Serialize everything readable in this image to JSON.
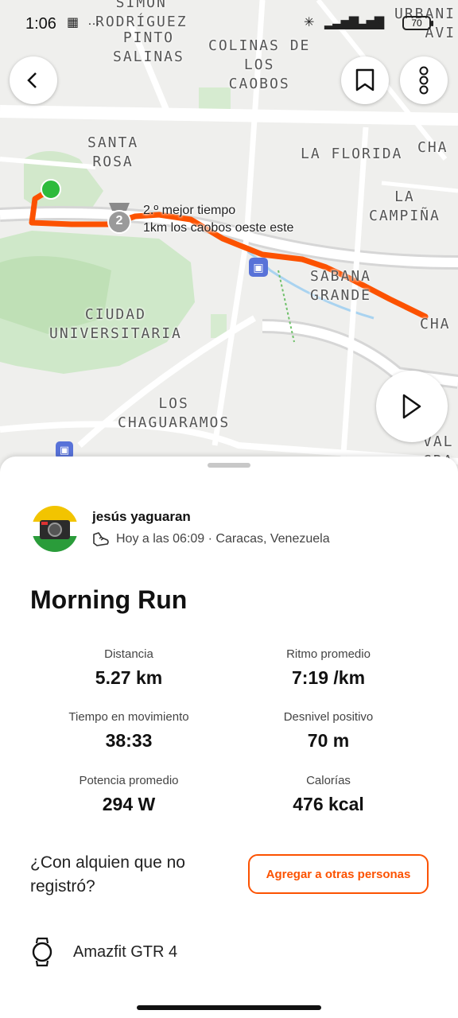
{
  "status_bar": {
    "time": "1:06",
    "battery": "70"
  },
  "map": {
    "labels": [
      {
        "id": "simon-rodriguez",
        "text": "SIMÓN\nRODRÍGUEZ"
      },
      {
        "id": "pinto-salinas",
        "text": "PINTO\nSALINAS"
      },
      {
        "id": "colinas",
        "text": "COLINAS DE\nLOS\nCAOBOS"
      },
      {
        "id": "urbani",
        "text": "URBANI\nAVI"
      },
      {
        "id": "santa-rosa",
        "text": "SANTA\nROSA"
      },
      {
        "id": "la-florida",
        "text": "LA FLORIDA"
      },
      {
        "id": "cha1",
        "text": "CHA"
      },
      {
        "id": "la-campina",
        "text": "LA\nCAMPIÑA"
      },
      {
        "id": "sabana-grande",
        "text": "SABANA\nGRANDE"
      },
      {
        "id": "cha2",
        "text": "CHA"
      },
      {
        "id": "ciudad-universitaria",
        "text": "CIUDAD\nUNIVERSITARIA"
      },
      {
        "id": "los-chaguaramos",
        "text": "LOS\nCHAGUARAMOS"
      },
      {
        "id": "val",
        "text": "VAL\nGRA"
      }
    ],
    "segment_badge": "2",
    "segment_label_line1": "2.º mejor tiempo",
    "segment_label_line2": "1km los caobos oeste este"
  },
  "athlete": {
    "name": "jesús yaguaran",
    "meta": "Hoy a las 06:09 · Caracas, Venezuela"
  },
  "activity": {
    "title": "Morning Run"
  },
  "stats": [
    {
      "label": "Distancia",
      "value": "5.27 km"
    },
    {
      "label": "Ritmo promedio",
      "value": "7:19 /km"
    },
    {
      "label": "Tiempo en movimiento",
      "value": "38:33"
    },
    {
      "label": "Desnivel positivo",
      "value": "70 m"
    },
    {
      "label": "Potencia promedio",
      "value": "294 W"
    },
    {
      "label": "Calorías",
      "value": "476 kcal"
    }
  ],
  "tag_prompt": "¿Con alquien que no registró?",
  "add_button_label": "Agregar a otras personas",
  "device": {
    "name": "Amazfit GTR 4",
    "icon": "watch-icon"
  },
  "colors": {
    "accent": "#fc5200",
    "start_marker": "#2dbb3c",
    "park": "#cfe8c9"
  }
}
